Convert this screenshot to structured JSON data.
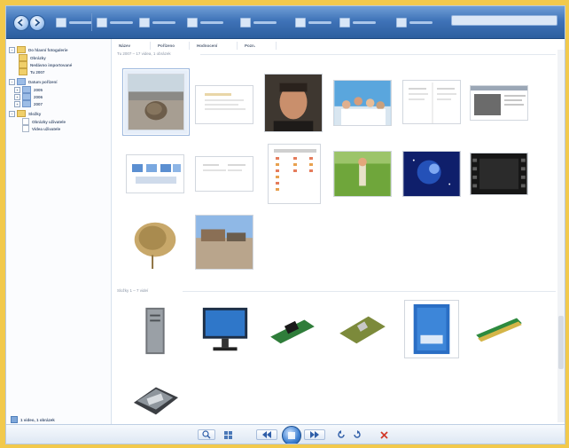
{
  "window": {
    "accent": "#3f73b8",
    "frame_color": "#f2c94c"
  },
  "toolbar": {
    "items": [
      {
        "icon": "file-icon"
      },
      {
        "icon": "fix-icon"
      },
      {
        "icon": "info-icon"
      },
      {
        "icon": "print-icon"
      },
      {
        "icon": "email-icon"
      },
      {
        "icon": "burn-icon"
      },
      {
        "icon": "movie-icon"
      },
      {
        "icon": "open-icon"
      }
    ],
    "search_placeholder": ""
  },
  "columns": [
    "Název",
    "Pořízeno",
    "Hodnocení",
    "Pozn."
  ],
  "tree": [
    {
      "label": "Do hlavní fotogalerie",
      "level": 0,
      "expander": "−",
      "icon": "folder"
    },
    {
      "label": "Obrázky",
      "level": 1,
      "expander": "",
      "icon": "folder"
    },
    {
      "label": "Nedávno importované",
      "level": 1,
      "expander": "",
      "icon": "folder"
    },
    {
      "label": "Tu 2007",
      "level": 1,
      "expander": "",
      "icon": "folder"
    },
    {
      "label": "Datum pořízení",
      "level": 0,
      "expander": "−",
      "icon": "blue"
    },
    {
      "label": "2005",
      "level": 1,
      "expander": "+",
      "icon": "blue"
    },
    {
      "label": "2006",
      "level": 1,
      "expander": "+",
      "icon": "blue"
    },
    {
      "label": "2007",
      "level": 1,
      "expander": "+",
      "icon": "blue"
    },
    {
      "label": "Složky",
      "level": 0,
      "expander": "−",
      "icon": "folder"
    },
    {
      "label": "Obrázky uživatele",
      "level": 1,
      "expander": "",
      "icon": "doc"
    },
    {
      "label": "Videa uživatele",
      "level": 1,
      "expander": "",
      "icon": "doc"
    }
  ],
  "groups": [
    {
      "label": "Tu 2007 – 17 videa, 1 obrázek"
    },
    {
      "label": "Složky 1 – 7 videí"
    }
  ],
  "thumbnails": [
    {
      "name": "tumbleweed-on-road",
      "kind": "photo"
    },
    {
      "name": "document-page-1",
      "kind": "document"
    },
    {
      "name": "portrait-man",
      "kind": "photo"
    },
    {
      "name": "group-people-sky",
      "kind": "photo"
    },
    {
      "name": "document-page-2",
      "kind": "document"
    },
    {
      "name": "webpage-screenshot",
      "kind": "document"
    },
    {
      "name": "diagram-blue-boxes",
      "kind": "document"
    },
    {
      "name": "document-page-3",
      "kind": "document"
    },
    {
      "name": "table-document",
      "kind": "document"
    },
    {
      "name": "child-in-field",
      "kind": "photo"
    },
    {
      "name": "blue-nebula",
      "kind": "photo"
    },
    {
      "name": "film-strip-video",
      "kind": "video"
    },
    {
      "name": "dry-plant",
      "kind": "photo"
    },
    {
      "name": "house-desert",
      "kind": "photo"
    },
    {
      "name": "pc-tower",
      "kind": "photo"
    },
    {
      "name": "lcd-monitor",
      "kind": "photo"
    },
    {
      "name": "graphics-card",
      "kind": "photo"
    },
    {
      "name": "motherboard",
      "kind": "photo"
    },
    {
      "name": "processor-box",
      "kind": "photo"
    },
    {
      "name": "ram-module",
      "kind": "photo"
    },
    {
      "name": "hard-drive",
      "kind": "photo"
    }
  ],
  "status": {
    "text": "1 video, 1 obrázek"
  },
  "controls": [
    {
      "name": "zoom-button",
      "icon": "magnifier-icon"
    },
    {
      "name": "actual-size-button",
      "icon": "grid-icon"
    },
    {
      "name": "previous-button",
      "icon": "prev-icon"
    },
    {
      "name": "slideshow-button",
      "icon": "play-icon"
    },
    {
      "name": "next-button",
      "icon": "next-icon"
    },
    {
      "name": "rotate-left-button",
      "icon": "rotate-left-icon"
    },
    {
      "name": "rotate-right-button",
      "icon": "rotate-right-icon"
    },
    {
      "name": "delete-button",
      "icon": "delete-icon"
    }
  ]
}
